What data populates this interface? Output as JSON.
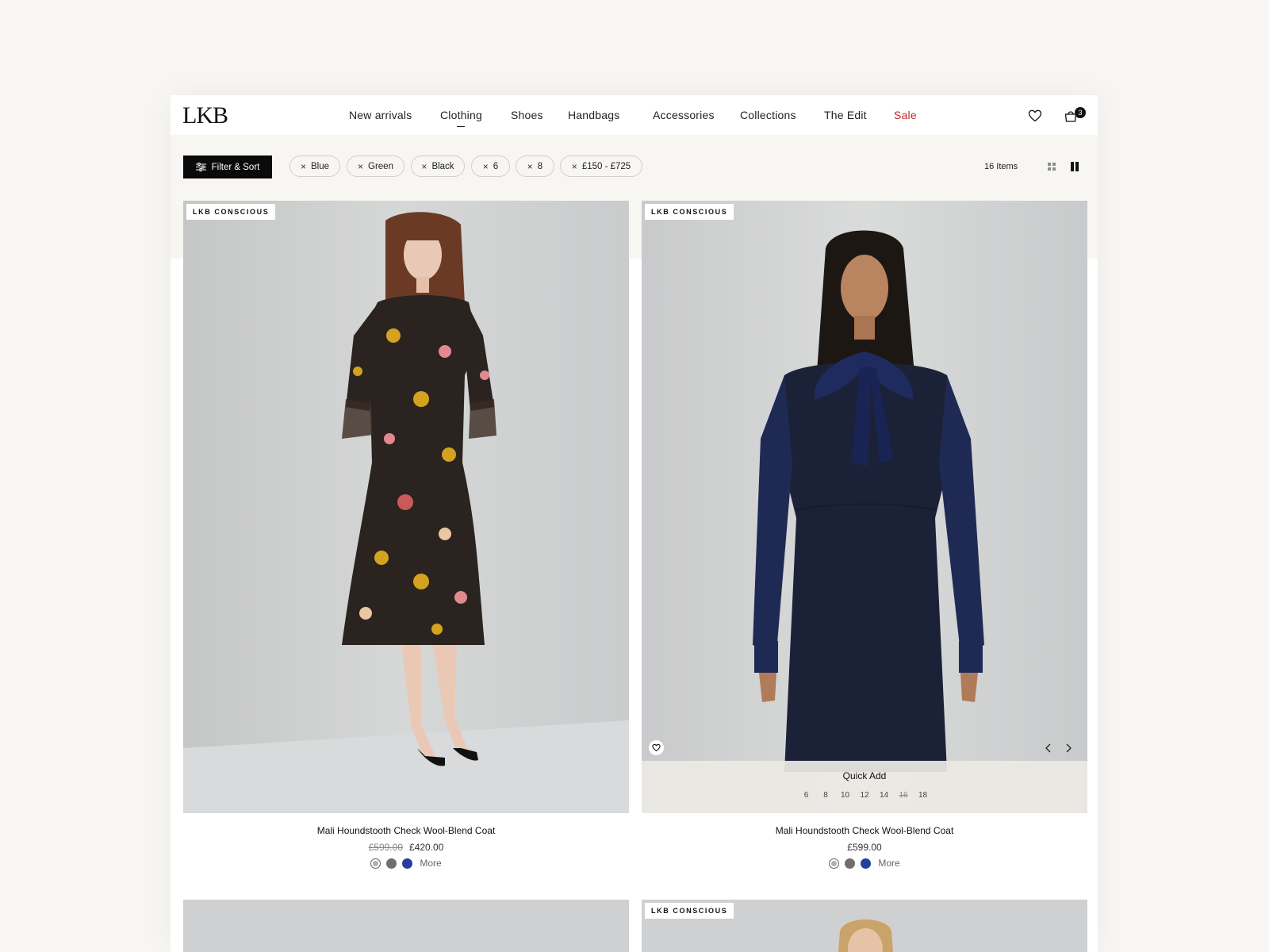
{
  "brand": {
    "logo": "LKB"
  },
  "nav": {
    "items": [
      {
        "label": "New arrivals"
      },
      {
        "label": "Clothing"
      },
      {
        "label": "Shoes"
      },
      {
        "label": "Handbags"
      },
      {
        "label": "Accessories"
      },
      {
        "label": "Collections"
      },
      {
        "label": "The Edit"
      },
      {
        "label": "Sale"
      }
    ],
    "active": "Clothing",
    "sale_color": "#c0282d"
  },
  "header_icons": {
    "wishlist": "heart-icon",
    "cart": "bag-icon",
    "cart_count": "3"
  },
  "filters": {
    "button_label": "Filter & Sort",
    "chips": [
      {
        "label": "Blue"
      },
      {
        "label": "Green"
      },
      {
        "label": "Black"
      },
      {
        "label": "6"
      },
      {
        "label": "8"
      },
      {
        "label": "£150 - £725"
      }
    ],
    "items_count": "16 Items",
    "view_options": [
      "grid-4-icon",
      "grid-2-icon"
    ],
    "active_view": "grid-2-icon"
  },
  "products": [
    {
      "badge": "LKB CONSCIOUS",
      "name": "Mali Houndstooth Check Wool-Blend Coat",
      "old_price": "£599.00",
      "price": "£420.00",
      "swatch_colors": [
        "#b9ae9d",
        "#6f6f6f",
        "#24409c"
      ],
      "more_label": "More"
    },
    {
      "badge": "LKB CONSCIOUS",
      "name": "Mali Houndstooth Check Wool-Blend Coat",
      "price": "£599.00",
      "swatch_colors": [
        "#b9ae9d",
        "#6f6f6f",
        "#24409c"
      ],
      "more_label": "More",
      "quick_add": {
        "title": "Quick Add",
        "sizes": [
          "6",
          "8",
          "10",
          "12",
          "14",
          "16",
          "18"
        ],
        "unavailable": [
          "16"
        ]
      }
    },
    {
      "badge": ""
    },
    {
      "badge": "LKB CONSCIOUS"
    }
  ]
}
